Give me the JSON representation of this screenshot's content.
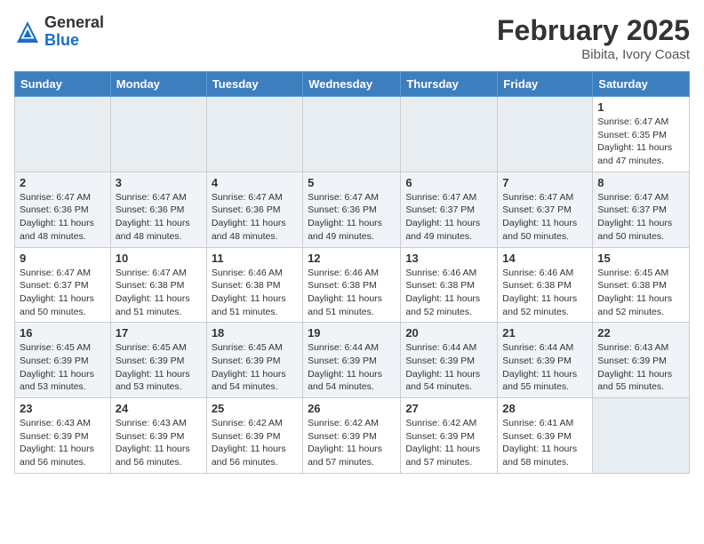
{
  "header": {
    "logo_general": "General",
    "logo_blue": "Blue",
    "month_title": "February 2025",
    "location": "Bibita, Ivory Coast"
  },
  "weekdays": [
    "Sunday",
    "Monday",
    "Tuesday",
    "Wednesday",
    "Thursday",
    "Friday",
    "Saturday"
  ],
  "weeks": [
    [
      {
        "day": "",
        "info": ""
      },
      {
        "day": "",
        "info": ""
      },
      {
        "day": "",
        "info": ""
      },
      {
        "day": "",
        "info": ""
      },
      {
        "day": "",
        "info": ""
      },
      {
        "day": "",
        "info": ""
      },
      {
        "day": "1",
        "info": "Sunrise: 6:47 AM\nSunset: 6:35 PM\nDaylight: 11 hours and 47 minutes."
      }
    ],
    [
      {
        "day": "2",
        "info": "Sunrise: 6:47 AM\nSunset: 6:36 PM\nDaylight: 11 hours and 48 minutes."
      },
      {
        "day": "3",
        "info": "Sunrise: 6:47 AM\nSunset: 6:36 PM\nDaylight: 11 hours and 48 minutes."
      },
      {
        "day": "4",
        "info": "Sunrise: 6:47 AM\nSunset: 6:36 PM\nDaylight: 11 hours and 48 minutes."
      },
      {
        "day": "5",
        "info": "Sunrise: 6:47 AM\nSunset: 6:36 PM\nDaylight: 11 hours and 49 minutes."
      },
      {
        "day": "6",
        "info": "Sunrise: 6:47 AM\nSunset: 6:37 PM\nDaylight: 11 hours and 49 minutes."
      },
      {
        "day": "7",
        "info": "Sunrise: 6:47 AM\nSunset: 6:37 PM\nDaylight: 11 hours and 50 minutes."
      },
      {
        "day": "8",
        "info": "Sunrise: 6:47 AM\nSunset: 6:37 PM\nDaylight: 11 hours and 50 minutes."
      }
    ],
    [
      {
        "day": "9",
        "info": "Sunrise: 6:47 AM\nSunset: 6:37 PM\nDaylight: 11 hours and 50 minutes."
      },
      {
        "day": "10",
        "info": "Sunrise: 6:47 AM\nSunset: 6:38 PM\nDaylight: 11 hours and 51 minutes."
      },
      {
        "day": "11",
        "info": "Sunrise: 6:46 AM\nSunset: 6:38 PM\nDaylight: 11 hours and 51 minutes."
      },
      {
        "day": "12",
        "info": "Sunrise: 6:46 AM\nSunset: 6:38 PM\nDaylight: 11 hours and 51 minutes."
      },
      {
        "day": "13",
        "info": "Sunrise: 6:46 AM\nSunset: 6:38 PM\nDaylight: 11 hours and 52 minutes."
      },
      {
        "day": "14",
        "info": "Sunrise: 6:46 AM\nSunset: 6:38 PM\nDaylight: 11 hours and 52 minutes."
      },
      {
        "day": "15",
        "info": "Sunrise: 6:45 AM\nSunset: 6:38 PM\nDaylight: 11 hours and 52 minutes."
      }
    ],
    [
      {
        "day": "16",
        "info": "Sunrise: 6:45 AM\nSunset: 6:39 PM\nDaylight: 11 hours and 53 minutes."
      },
      {
        "day": "17",
        "info": "Sunrise: 6:45 AM\nSunset: 6:39 PM\nDaylight: 11 hours and 53 minutes."
      },
      {
        "day": "18",
        "info": "Sunrise: 6:45 AM\nSunset: 6:39 PM\nDaylight: 11 hours and 54 minutes."
      },
      {
        "day": "19",
        "info": "Sunrise: 6:44 AM\nSunset: 6:39 PM\nDaylight: 11 hours and 54 minutes."
      },
      {
        "day": "20",
        "info": "Sunrise: 6:44 AM\nSunset: 6:39 PM\nDaylight: 11 hours and 54 minutes."
      },
      {
        "day": "21",
        "info": "Sunrise: 6:44 AM\nSunset: 6:39 PM\nDaylight: 11 hours and 55 minutes."
      },
      {
        "day": "22",
        "info": "Sunrise: 6:43 AM\nSunset: 6:39 PM\nDaylight: 11 hours and 55 minutes."
      }
    ],
    [
      {
        "day": "23",
        "info": "Sunrise: 6:43 AM\nSunset: 6:39 PM\nDaylight: 11 hours and 56 minutes."
      },
      {
        "day": "24",
        "info": "Sunrise: 6:43 AM\nSunset: 6:39 PM\nDaylight: 11 hours and 56 minutes."
      },
      {
        "day": "25",
        "info": "Sunrise: 6:42 AM\nSunset: 6:39 PM\nDaylight: 11 hours and 56 minutes."
      },
      {
        "day": "26",
        "info": "Sunrise: 6:42 AM\nSunset: 6:39 PM\nDaylight: 11 hours and 57 minutes."
      },
      {
        "day": "27",
        "info": "Sunrise: 6:42 AM\nSunset: 6:39 PM\nDaylight: 11 hours and 57 minutes."
      },
      {
        "day": "28",
        "info": "Sunrise: 6:41 AM\nSunset: 6:39 PM\nDaylight: 11 hours and 58 minutes."
      },
      {
        "day": "",
        "info": ""
      }
    ]
  ]
}
